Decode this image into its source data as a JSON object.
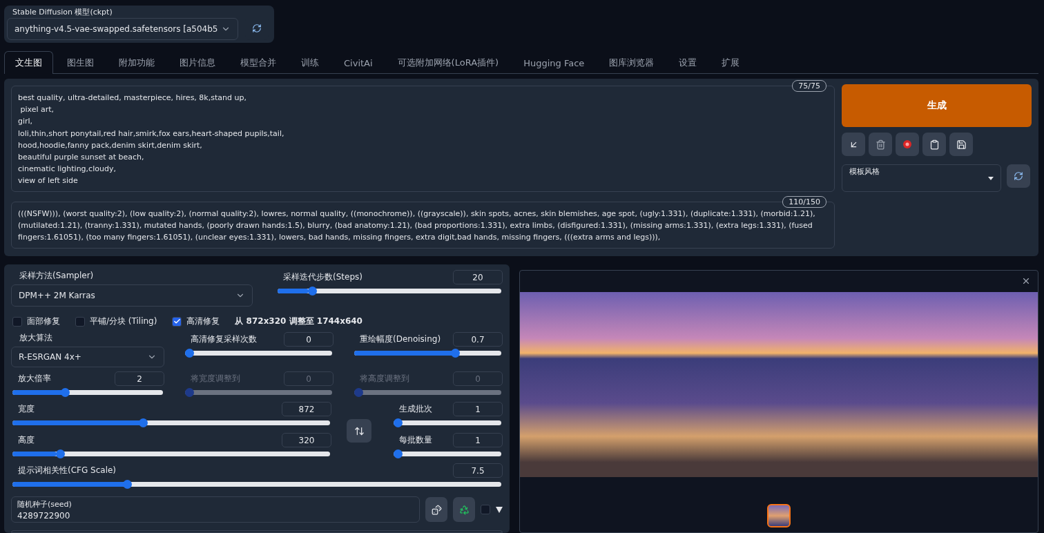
{
  "model_select": {
    "label": "Stable Diffusion 模型(ckpt)",
    "value": "anything-v4.5-vae-swapped.safetensors [a504b5"
  },
  "tabs": [
    {
      "label": "文生图",
      "selected": true
    },
    {
      "label": "图生图",
      "selected": false
    },
    {
      "label": "附加功能",
      "selected": false
    },
    {
      "label": "图片信息",
      "selected": false
    },
    {
      "label": "模型合并",
      "selected": false
    },
    {
      "label": "训练",
      "selected": false
    },
    {
      "label": "CivitAi",
      "selected": false
    },
    {
      "label": "可选附加网络(LoRA插件)",
      "selected": false
    },
    {
      "label": "Hugging Face",
      "selected": false
    },
    {
      "label": "图库浏览器",
      "selected": false
    },
    {
      "label": "设置",
      "selected": false
    },
    {
      "label": "扩展",
      "selected": false
    }
  ],
  "prompt": {
    "text": "best quality, ultra-detailed, masterpiece, hires, 8k,stand up,\n pixel art,\ngirl,\nloli,thin,short ponytail,red hair,smirk,fox ears,heart-shaped pupils,tail,\nhood,hoodie,fanny pack,denim skirt,denim skirt,\nbeautiful purple sunset at beach,\ncinematic lighting,cloudy,\nview of left side",
    "counter": "75/75"
  },
  "negative_prompt": {
    "text": "(((NSFW))), (worst quality:2), (low quality:2), (normal quality:2), lowres, normal quality, ((monochrome)), ((grayscale)), skin spots, acnes, skin blemishes, age spot, (ugly:1.331), (duplicate:1.331), (morbid:1.21), (mutilated:1.21), (tranny:1.331), mutated hands, (poorly drawn hands:1.5), blurry, (bad anatomy:1.21), (bad proportions:1.331), extra limbs, (disfigured:1.331), (missing arms:1.331), (extra legs:1.331), (fused fingers:1.61051), (too many fingers:1.61051), (unclear eyes:1.331), lowers, bad hands, missing fingers, extra digit,bad hands, missing fingers, (((extra arms and legs))),",
    "counter": "110/150"
  },
  "generate_button": "生成",
  "styles": {
    "label": "模板风格"
  },
  "sampler": {
    "label": "采样方法(Sampler)",
    "value": "DPM++ 2M Karras"
  },
  "steps": {
    "label": "采样迭代步数(Steps)",
    "value": "20",
    "level": 0.14,
    "disabled": false
  },
  "checkboxes": [
    {
      "label": "面部修复",
      "checked": false
    },
    {
      "label": "平铺/分块 (Tiling)",
      "checked": false
    },
    {
      "label": "高清修复",
      "checked": true
    }
  ],
  "hires_info": "从 872x320 调整至 1744x640",
  "upscaler": {
    "label": "放大算法",
    "value": "R-ESRGAN 4x+"
  },
  "hires_sliders": [
    {
      "label": "高清修复采样次数",
      "value": "0",
      "level": 0,
      "disabled": false
    },
    {
      "label": "重绘幅度(Denoising)",
      "value": "0.7",
      "level": 0.7,
      "disabled": false
    },
    {
      "label": "放大倍率",
      "value": "2",
      "level": 0.34,
      "disabled": false
    },
    {
      "label": "将宽度调整到",
      "value": "0",
      "level": 0,
      "disabled": true
    },
    {
      "label": "将高度调整到",
      "value": "0",
      "level": 0,
      "disabled": true
    }
  ],
  "size_sliders": [
    {
      "label": "宽度",
      "value": "872",
      "level": 0.41,
      "disabled": false
    },
    {
      "label": "高度",
      "value": "320",
      "level": 0.14,
      "disabled": false
    }
  ],
  "batch_sliders": [
    {
      "label": "生成批次",
      "value": "1",
      "level": 0,
      "disabled": false
    },
    {
      "label": "每批数量",
      "value": "1",
      "level": 0,
      "disabled": false
    }
  ],
  "cfg": {
    "label": "提示词相关性(CFG Scale)",
    "value": "7.5",
    "level": 0.23,
    "disabled": false
  },
  "seed": {
    "label": "随机种子(seed)",
    "value": "4289722900",
    "extra_checked": false
  },
  "gallery": {
    "thumbnails": [
      {
        "selected": true
      }
    ]
  }
}
